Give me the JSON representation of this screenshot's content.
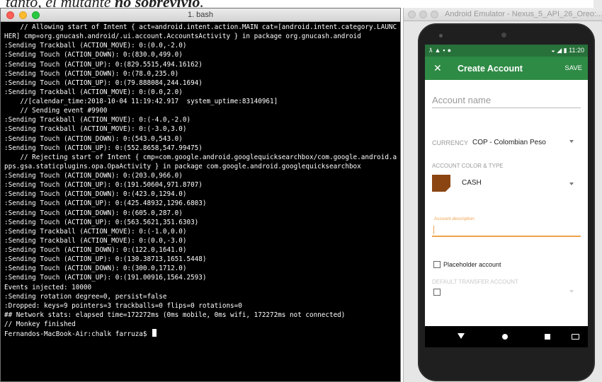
{
  "background": {
    "heading_pre": "tanto, el mutante ",
    "heading_bold": "no sobrevivió",
    "heading_post": "."
  },
  "terminal": {
    "title": "1. bash",
    "lines": [
      "    // Allowing start of Intent { act=android.intent.action.MAIN cat=[android.intent.category.LAUNCHER] cmp=org.gnucash.android/.ui.account.AccountsActivity } in package org.gnucash.android",
      ":Sending Trackball (ACTION_MOVE): 0:(0.0,-2.0)",
      ":Sending Touch (ACTION_DOWN): 0:(830.0,499.0)",
      ":Sending Touch (ACTION_UP): 0:(829.5515,494.16162)",
      ":Sending Touch (ACTION_DOWN): 0:(78.0,235.0)",
      ":Sending Touch (ACTION_UP): 0:(79.888084,244.1694)",
      ":Sending Trackball (ACTION_MOVE): 0:(0.0,2.0)",
      "    //[calendar_time:2018-10-04 11:19:42.917  system_uptime:83140961]",
      "    // Sending event #9900",
      ":Sending Trackball (ACTION_MOVE): 0:(-4.0,-2.0)",
      ":Sending Trackball (ACTION_MOVE): 0:(-3.0,3.0)",
      ":Sending Touch (ACTION_DOWN): 0:(543.0,543.0)",
      ":Sending Touch (ACTION_UP): 0:(552.8658,547.99475)",
      "    // Rejecting start of Intent { cmp=com.google.android.googlequicksearchbox/com.google.android.apps.gsa.staticplugins.opa.OpaActivity } in package com.google.android.googlequicksearchbox",
      ":Sending Touch (ACTION_DOWN): 0:(203.0,966.0)",
      ":Sending Touch (ACTION_UP): 0:(191.50604,971.8707)",
      ":Sending Touch (ACTION_DOWN): 0:(423.0,1294.0)",
      ":Sending Touch (ACTION_UP): 0:(425.48932,1296.6803)",
      ":Sending Touch (ACTION_DOWN): 0:(605.0,287.0)",
      ":Sending Touch (ACTION_UP): 0:(563.5621,351.6303)",
      ":Sending Trackball (ACTION_MOVE): 0:(-1.0,0.0)",
      ":Sending Trackball (ACTION_MOVE): 0:(0.0,-3.0)",
      ":Sending Touch (ACTION_DOWN): 0:(122.0,1641.0)",
      ":Sending Touch (ACTION_UP): 0:(130.38713,1651.5448)",
      ":Sending Touch (ACTION_DOWN): 0:(300.0,1712.0)",
      ":Sending Touch (ACTION_UP): 0:(191.00916,1564.2593)",
      "Events injected: 10000",
      ":Sending rotation degree=0, persist=false",
      ":Dropped: keys=9 pointers=3 trackballs=0 flips=0 rotations=0",
      "## Network stats: elapsed time=172272ms (0ms mobile, 0ms wifi, 172272ms not connected)",
      "// Monkey finished"
    ],
    "prompt": "Fernandos-MacBook-Air:chalk farruza$ "
  },
  "emulator": {
    "window_title": "Android Emulator - Nexus_5_API_26_Oreo:...",
    "status_time": "11:20",
    "appbar": {
      "title": "Create Account",
      "save_label": "SAVE"
    },
    "form": {
      "account_name_placeholder": "Account name",
      "currency_label": "CURRENCY",
      "currency_value": "COP - Colombian Peso",
      "color_type_label": "ACCOUNT COLOR & TYPE",
      "account_type": "CASH",
      "swatch_color": "#8b4513",
      "description_label": "Account description",
      "placeholder_label": "Placeholder account",
      "default_transfer_label": "DEFAULT TRANSFER ACCOUNT"
    }
  },
  "colors": {
    "appbar": "#2e8b45",
    "statusbar": "#27713a",
    "accent": "#f0a24c"
  }
}
